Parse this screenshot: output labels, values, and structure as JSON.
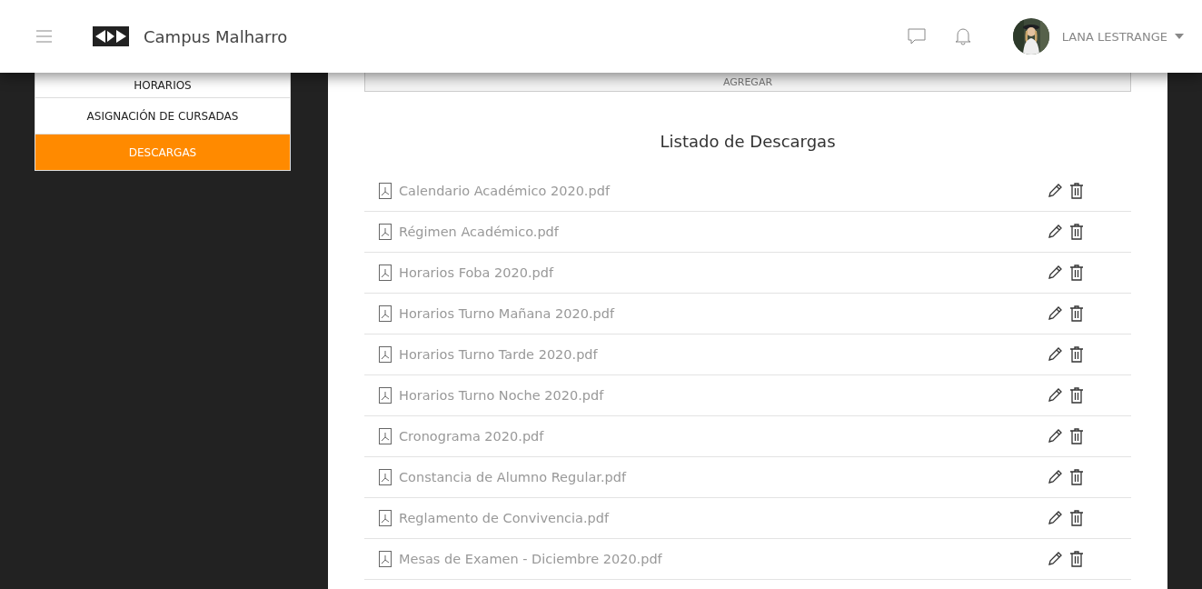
{
  "header": {
    "brand": "Campus Malharro",
    "user": {
      "name": "LANA LESTRANGE"
    }
  },
  "sidebar": {
    "items": [
      {
        "label": "HORARIOS",
        "selected": false
      },
      {
        "label": "ASIGNACIÓN DE CURSADAS",
        "selected": false
      },
      {
        "label": "DESCARGAS",
        "selected": true
      }
    ]
  },
  "main": {
    "add_button": "AGREGAR",
    "title": "Listado de Descargas",
    "files": [
      {
        "name": "Calendario Académico 2020.pdf"
      },
      {
        "name": "Régimen Académico.pdf"
      },
      {
        "name": "Horarios Foba 2020.pdf"
      },
      {
        "name": "Horarios Turno Mañana 2020.pdf"
      },
      {
        "name": "Horarios Turno Tarde 2020.pdf"
      },
      {
        "name": "Horarios Turno Noche 2020.pdf"
      },
      {
        "name": "Cronograma 2020.pdf"
      },
      {
        "name": "Constancia de Alumno Regular.pdf"
      },
      {
        "name": "Reglamento de Convivencia.pdf"
      },
      {
        "name": "Mesas de Examen - Diciembre 2020.pdf"
      }
    ]
  }
}
